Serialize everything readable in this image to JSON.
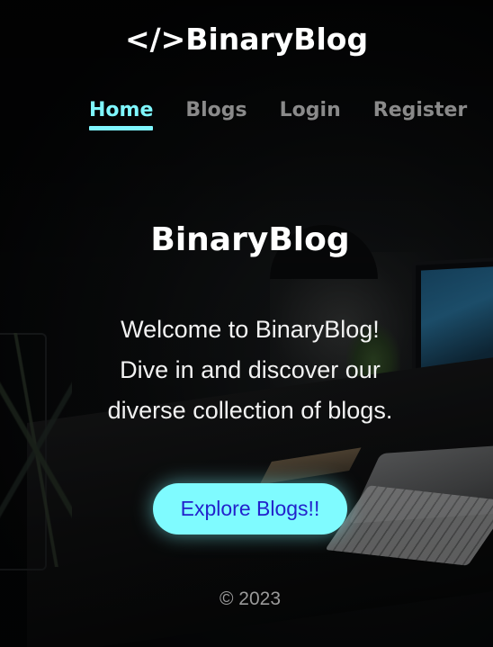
{
  "brand": {
    "logo_text": "</>BinaryBlog"
  },
  "nav": {
    "items": [
      {
        "label": "Home",
        "active": true
      },
      {
        "label": "Blogs",
        "active": false
      },
      {
        "label": "Login",
        "active": false
      },
      {
        "label": "Register",
        "active": false
      }
    ]
  },
  "hero": {
    "title": "BinaryBlog",
    "lines": [
      "Welcome to BinaryBlog!",
      "Dive in and discover our",
      "diverse collection of blogs."
    ],
    "cta_label": "Explore Blogs!!"
  },
  "footer": {
    "text": "© 2023"
  },
  "colors": {
    "accent": "#7ff7ff",
    "cta_background": "#7ffbff",
    "cta_text": "#2222cc",
    "nav_inactive": "#8a8a8a",
    "background": "#050607"
  }
}
